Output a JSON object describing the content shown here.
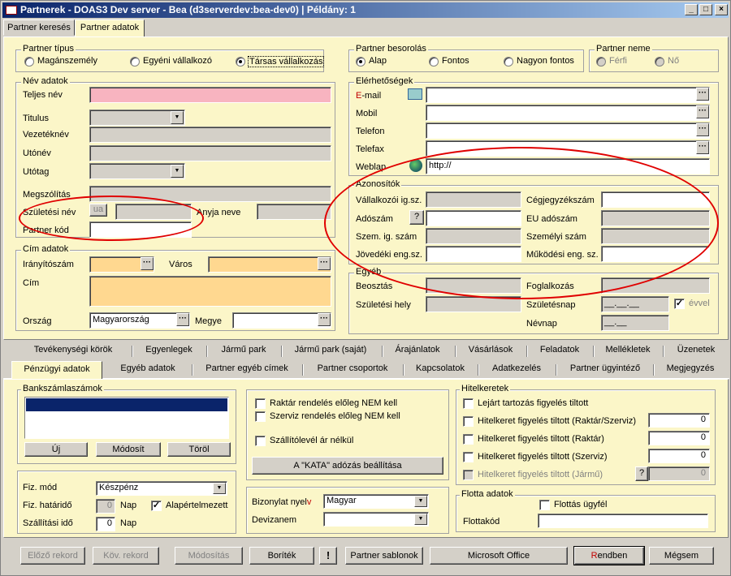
{
  "window": {
    "title": "Partnerek - DOAS3 Dev server - Bea (d3serverdev:bea-dev0) | Példány: 1",
    "btn_min": "_",
    "btn_max": "□",
    "btn_close": "×"
  },
  "top_tabs": [
    "Partner keresés",
    "Partner adatok"
  ],
  "partner_tipus": {
    "title": "Partner típus",
    "options": [
      "Magánszemély",
      "Egyéni vállalkozó",
      "Társas vállalkozás"
    ],
    "selected": 2
  },
  "partner_besorolas": {
    "title": "Partner besorolás",
    "options": [
      "Alap",
      "Fontos",
      "Nagyon fontos"
    ],
    "selected": 0
  },
  "partner_neme": {
    "title": "Partner neme",
    "options": [
      "Férfi",
      "Nő"
    ]
  },
  "nev_adatok": {
    "title": "Név adatok",
    "teljes_nev": "Teljes név",
    "titulus": "Titulus",
    "vezeteknev": "Vezetéknév",
    "utonev": "Utónév",
    "utotag": "Utótag",
    "megszolitas": "Megszólítás",
    "szuletesi_nev": "Születési név",
    "ua": "ua",
    "anyja_neve": "Anyja neve",
    "partner_kod": "Partner kód"
  },
  "cim_adatok": {
    "title": "Cím adatok",
    "iranyitoszam": "Irányítószám",
    "varos": "Város",
    "cim": "Cím",
    "orszag": "Ország",
    "orszag_value": "Magyarország",
    "megye": "Megye"
  },
  "elerhetosegek": {
    "title": "Elérhetőségek",
    "email_e": "E",
    "email_rest": "-mail",
    "mobil": "Mobil",
    "telefon": "Telefon",
    "telefax": "Telefax",
    "weblap": "Weblap",
    "weblap_value": "http://"
  },
  "azonositok": {
    "title": "Azonosítók",
    "vallalkozoi": "Vállalkozói ig.sz.",
    "cegjegyzek": "Cégjegyzékszám",
    "adoszam": "Adószám",
    "adoszam_help": "?",
    "eu_adoszam": "EU adószám",
    "szem_ig": "Szem. ig. szám",
    "szemelyi": "Személyi szám",
    "jovedeki": "Jövedéki eng.sz.",
    "mukodesi": "Működési eng. sz."
  },
  "egyeb": {
    "title": "Egyéb",
    "beosztas": "Beosztás",
    "foglalkozas": "Foglalkozás",
    "szuletesi_hely": "Születési hely",
    "szuletesnap": "Születésnap",
    "szuletesnap_value": "__.__.__",
    "evvel": "évvel",
    "nevnap": "Névnap",
    "nevnap_value": "__.__"
  },
  "nav_tabs_row1": [
    "Tevékenységi körök",
    "Egyenlegek",
    "Jármű park",
    "Jármű park (saját)",
    "Árajánlatok",
    "Vásárlások",
    "Feladatok",
    "Mellékletek",
    "Üzenetek"
  ],
  "nav_tabs_row2": [
    "Pénzügyi adatok",
    "Egyéb adatok",
    "Partner egyéb címek",
    "Partner csoportok",
    "Kapcsolatok",
    "Adatkezelés",
    "Partner ügyintéző",
    "Megjegyzés"
  ],
  "bank": {
    "title": "Bankszámlaszámok",
    "uj": "Új",
    "modosit": "Módosít",
    "torol": "Töröl"
  },
  "fizetes": {
    "fiz_mod": "Fiz. mód",
    "fiz_mod_value": "Készpénz",
    "fiz_hatarido": "Fiz. határidő",
    "fiz_hatarido_value": "0",
    "nap1": "Nap",
    "alapertelmezett": "Alapértelmezett",
    "szallitasi_ido": "Szállítási idő",
    "szallitasi_ido_value": "0",
    "nap2": "Nap"
  },
  "rendeles": {
    "raktar": "Raktár rendelés előleg NEM kell",
    "szerviz": "Szerviz rendelés előleg NEM kell",
    "szallitolevel": "Szállítólevél ár nélkül",
    "kata_btn": "A \"KATA\" adózás beállítása"
  },
  "bizonylat": {
    "nyelv_label": "Bizonylat nyel",
    "nyelv_v": "v",
    "nyelv_value": "Magyar",
    "devizanem": "Devizanem"
  },
  "hitelkeretek": {
    "title": "Hitelkeretek",
    "lejart": "Lejárt tartozás figyelés tiltott",
    "raktar_szerviz": "Hitelkeret figyelés tiltott (Raktár/Szerviz)",
    "raktar": "Hitelkeret figyelés tiltott (Raktár)",
    "szerviz": "Hitelkeret figyelés tiltott (Szerviz)",
    "jarmu": "Hitelkeret figyelés tiltott (Jármű)",
    "v1": "0",
    "v2": "0",
    "v3": "0",
    "v4": "0",
    "help": "?"
  },
  "flotta": {
    "title": "Flotta adatok",
    "flottas": "Flottás ügyfél",
    "flottakod": "Flottakód"
  },
  "bottom_buttons": {
    "elozo": "Előző rekord",
    "kov": "Köv. rekord",
    "modositas": "Módosítás",
    "boritek": "Boríték",
    "excl": "!",
    "sablonok": "Partner sablonok",
    "office": "Microsoft Office",
    "rendben_r": "R",
    "rendben_rest": "endben",
    "megsem": "Mégsem"
  },
  "annotation_color": "#e00000"
}
